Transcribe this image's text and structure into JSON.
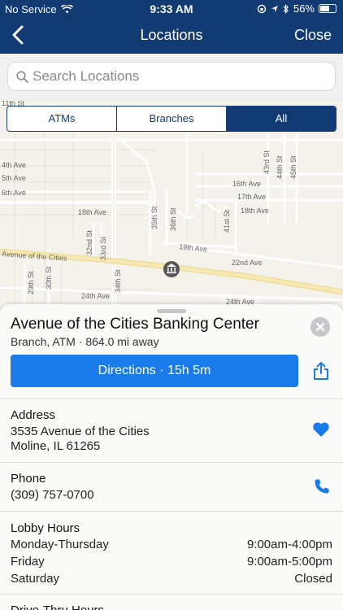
{
  "status_bar": {
    "carrier": "No Service",
    "time": "9:33 AM",
    "battery": "56%"
  },
  "nav": {
    "title": "Locations",
    "close_label": "Close"
  },
  "search": {
    "placeholder": "Search Locations"
  },
  "filter_tabs": [
    {
      "label": "ATMs",
      "active": false
    },
    {
      "label": "Branches",
      "active": false
    },
    {
      "label": "All",
      "active": true
    }
  ],
  "map": {
    "labels": {
      "st_11th": "11th St",
      "ave_4th": "4th Ave",
      "ave_5th": "5th Ave",
      "ave_6th": "6th Ave",
      "ave_16th": "16th Ave",
      "ave_17th": "17th Ave",
      "ave_18th_left": "18th Ave",
      "ave_18th_right": "18th Ave",
      "ave_19th": "19th Ave",
      "ave_22nd": "22nd Ave",
      "ave_24th_left": "24th Ave",
      "ave_24th_right": "24th Ave",
      "ave_cities": "Avenue of the Cities",
      "st_29th": "29th St",
      "st_30th": "30th St",
      "st_32nd": "32nd St",
      "st_33rd": "33rd St",
      "st_34th": "34th St",
      "st_35th": "35th St",
      "st_36th": "36th St",
      "st_41st": "41st St",
      "st_43rd": "43rd St",
      "st_44th": "44th St",
      "st_45th": "45th St"
    }
  },
  "location": {
    "name": "Avenue of the Cities Banking Center",
    "subtitle": "Branch, ATM · 864.0 mi away",
    "directions_label": "Directions · 15h 5m"
  },
  "address": {
    "title": "Address",
    "line1": "3535 Avenue of the Cities",
    "line2": "Moline, IL 61265"
  },
  "phone": {
    "title": "Phone",
    "number": "(309) 757-0700"
  },
  "lobby_hours": {
    "title": "Lobby Hours",
    "rows": [
      {
        "day": "Monday-Thursday",
        "hours": "9:00am-4:00pm"
      },
      {
        "day": "Friday",
        "hours": "9:00am-5:00pm"
      },
      {
        "day": "Saturday",
        "hours": "Closed"
      }
    ]
  },
  "next_section": {
    "title": "Drive-Thru Hours"
  },
  "colors": {
    "nav": "#123b73",
    "accent": "#1a7bea",
    "bank_pin": "#555555"
  }
}
